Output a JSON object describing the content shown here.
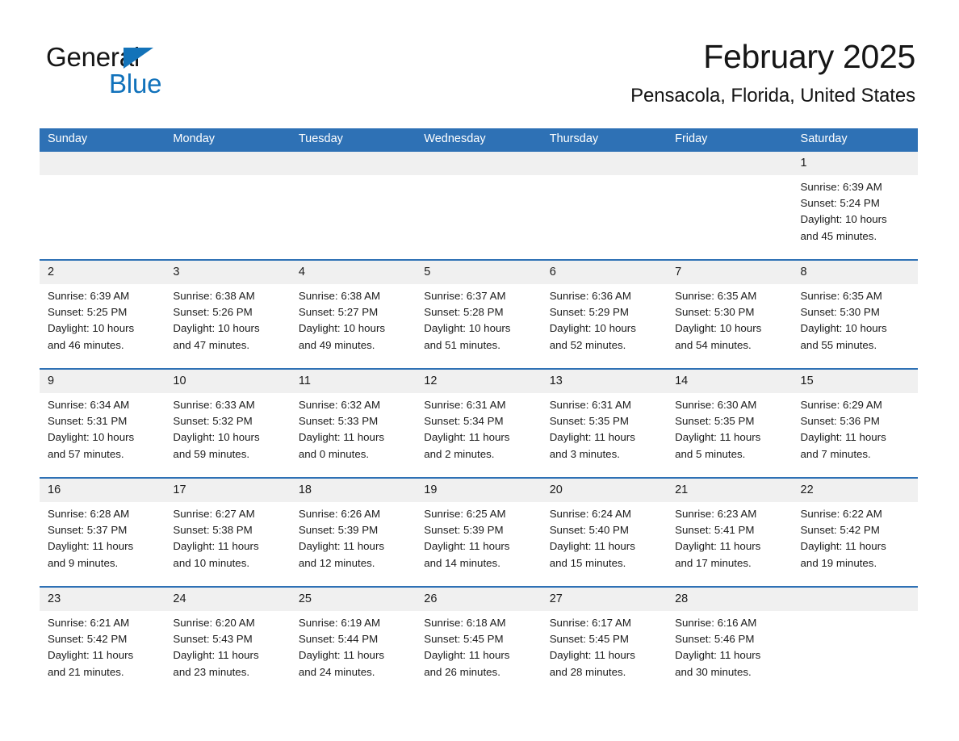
{
  "brand": {
    "name_part1": "General",
    "name_part2": "Blue",
    "triangle_color": "#1373b9",
    "blue_color": "#1172bb"
  },
  "header": {
    "title": "February 2025",
    "subtitle": "Pensacola, Florida, United States"
  },
  "theme": {
    "header_blue": "#2e71b5",
    "day_band_gray": "#f0f0f0",
    "text_color": "#1b1b1b",
    "cell_background": "#ffffff"
  },
  "weekdays": [
    "Sunday",
    "Monday",
    "Tuesday",
    "Wednesday",
    "Thursday",
    "Friday",
    "Saturday"
  ],
  "weeks": [
    [
      {
        "empty": true
      },
      {
        "empty": true
      },
      {
        "empty": true
      },
      {
        "empty": true
      },
      {
        "empty": true
      },
      {
        "empty": true
      },
      {
        "day": "1",
        "sunrise": "Sunrise: 6:39 AM",
        "sunset": "Sunset: 5:24 PM",
        "daylight_line1": "Daylight: 10 hours",
        "daylight_line2": "and 45 minutes."
      }
    ],
    [
      {
        "day": "2",
        "sunrise": "Sunrise: 6:39 AM",
        "sunset": "Sunset: 5:25 PM",
        "daylight_line1": "Daylight: 10 hours",
        "daylight_line2": "and 46 minutes."
      },
      {
        "day": "3",
        "sunrise": "Sunrise: 6:38 AM",
        "sunset": "Sunset: 5:26 PM",
        "daylight_line1": "Daylight: 10 hours",
        "daylight_line2": "and 47 minutes."
      },
      {
        "day": "4",
        "sunrise": "Sunrise: 6:38 AM",
        "sunset": "Sunset: 5:27 PM",
        "daylight_line1": "Daylight: 10 hours",
        "daylight_line2": "and 49 minutes."
      },
      {
        "day": "5",
        "sunrise": "Sunrise: 6:37 AM",
        "sunset": "Sunset: 5:28 PM",
        "daylight_line1": "Daylight: 10 hours",
        "daylight_line2": "and 51 minutes."
      },
      {
        "day": "6",
        "sunrise": "Sunrise: 6:36 AM",
        "sunset": "Sunset: 5:29 PM",
        "daylight_line1": "Daylight: 10 hours",
        "daylight_line2": "and 52 minutes."
      },
      {
        "day": "7",
        "sunrise": "Sunrise: 6:35 AM",
        "sunset": "Sunset: 5:30 PM",
        "daylight_line1": "Daylight: 10 hours",
        "daylight_line2": "and 54 minutes."
      },
      {
        "day": "8",
        "sunrise": "Sunrise: 6:35 AM",
        "sunset": "Sunset: 5:30 PM",
        "daylight_line1": "Daylight: 10 hours",
        "daylight_line2": "and 55 minutes."
      }
    ],
    [
      {
        "day": "9",
        "sunrise": "Sunrise: 6:34 AM",
        "sunset": "Sunset: 5:31 PM",
        "daylight_line1": "Daylight: 10 hours",
        "daylight_line2": "and 57 minutes."
      },
      {
        "day": "10",
        "sunrise": "Sunrise: 6:33 AM",
        "sunset": "Sunset: 5:32 PM",
        "daylight_line1": "Daylight: 10 hours",
        "daylight_line2": "and 59 minutes."
      },
      {
        "day": "11",
        "sunrise": "Sunrise: 6:32 AM",
        "sunset": "Sunset: 5:33 PM",
        "daylight_line1": "Daylight: 11 hours",
        "daylight_line2": "and 0 minutes."
      },
      {
        "day": "12",
        "sunrise": "Sunrise: 6:31 AM",
        "sunset": "Sunset: 5:34 PM",
        "daylight_line1": "Daylight: 11 hours",
        "daylight_line2": "and 2 minutes."
      },
      {
        "day": "13",
        "sunrise": "Sunrise: 6:31 AM",
        "sunset": "Sunset: 5:35 PM",
        "daylight_line1": "Daylight: 11 hours",
        "daylight_line2": "and 3 minutes."
      },
      {
        "day": "14",
        "sunrise": "Sunrise: 6:30 AM",
        "sunset": "Sunset: 5:35 PM",
        "daylight_line1": "Daylight: 11 hours",
        "daylight_line2": "and 5 minutes."
      },
      {
        "day": "15",
        "sunrise": "Sunrise: 6:29 AM",
        "sunset": "Sunset: 5:36 PM",
        "daylight_line1": "Daylight: 11 hours",
        "daylight_line2": "and 7 minutes."
      }
    ],
    [
      {
        "day": "16",
        "sunrise": "Sunrise: 6:28 AM",
        "sunset": "Sunset: 5:37 PM",
        "daylight_line1": "Daylight: 11 hours",
        "daylight_line2": "and 9 minutes."
      },
      {
        "day": "17",
        "sunrise": "Sunrise: 6:27 AM",
        "sunset": "Sunset: 5:38 PM",
        "daylight_line1": "Daylight: 11 hours",
        "daylight_line2": "and 10 minutes."
      },
      {
        "day": "18",
        "sunrise": "Sunrise: 6:26 AM",
        "sunset": "Sunset: 5:39 PM",
        "daylight_line1": "Daylight: 11 hours",
        "daylight_line2": "and 12 minutes."
      },
      {
        "day": "19",
        "sunrise": "Sunrise: 6:25 AM",
        "sunset": "Sunset: 5:39 PM",
        "daylight_line1": "Daylight: 11 hours",
        "daylight_line2": "and 14 minutes."
      },
      {
        "day": "20",
        "sunrise": "Sunrise: 6:24 AM",
        "sunset": "Sunset: 5:40 PM",
        "daylight_line1": "Daylight: 11 hours",
        "daylight_line2": "and 15 minutes."
      },
      {
        "day": "21",
        "sunrise": "Sunrise: 6:23 AM",
        "sunset": "Sunset: 5:41 PM",
        "daylight_line1": "Daylight: 11 hours",
        "daylight_line2": "and 17 minutes."
      },
      {
        "day": "22",
        "sunrise": "Sunrise: 6:22 AM",
        "sunset": "Sunset: 5:42 PM",
        "daylight_line1": "Daylight: 11 hours",
        "daylight_line2": "and 19 minutes."
      }
    ],
    [
      {
        "day": "23",
        "sunrise": "Sunrise: 6:21 AM",
        "sunset": "Sunset: 5:42 PM",
        "daylight_line1": "Daylight: 11 hours",
        "daylight_line2": "and 21 minutes."
      },
      {
        "day": "24",
        "sunrise": "Sunrise: 6:20 AM",
        "sunset": "Sunset: 5:43 PM",
        "daylight_line1": "Daylight: 11 hours",
        "daylight_line2": "and 23 minutes."
      },
      {
        "day": "25",
        "sunrise": "Sunrise: 6:19 AM",
        "sunset": "Sunset: 5:44 PM",
        "daylight_line1": "Daylight: 11 hours",
        "daylight_line2": "and 24 minutes."
      },
      {
        "day": "26",
        "sunrise": "Sunrise: 6:18 AM",
        "sunset": "Sunset: 5:45 PM",
        "daylight_line1": "Daylight: 11 hours",
        "daylight_line2": "and 26 minutes."
      },
      {
        "day": "27",
        "sunrise": "Sunrise: 6:17 AM",
        "sunset": "Sunset: 5:45 PM",
        "daylight_line1": "Daylight: 11 hours",
        "daylight_line2": "and 28 minutes."
      },
      {
        "day": "28",
        "sunrise": "Sunrise: 6:16 AM",
        "sunset": "Sunset: 5:46 PM",
        "daylight_line1": "Daylight: 11 hours",
        "daylight_line2": "and 30 minutes."
      },
      {
        "empty": true
      }
    ]
  ]
}
